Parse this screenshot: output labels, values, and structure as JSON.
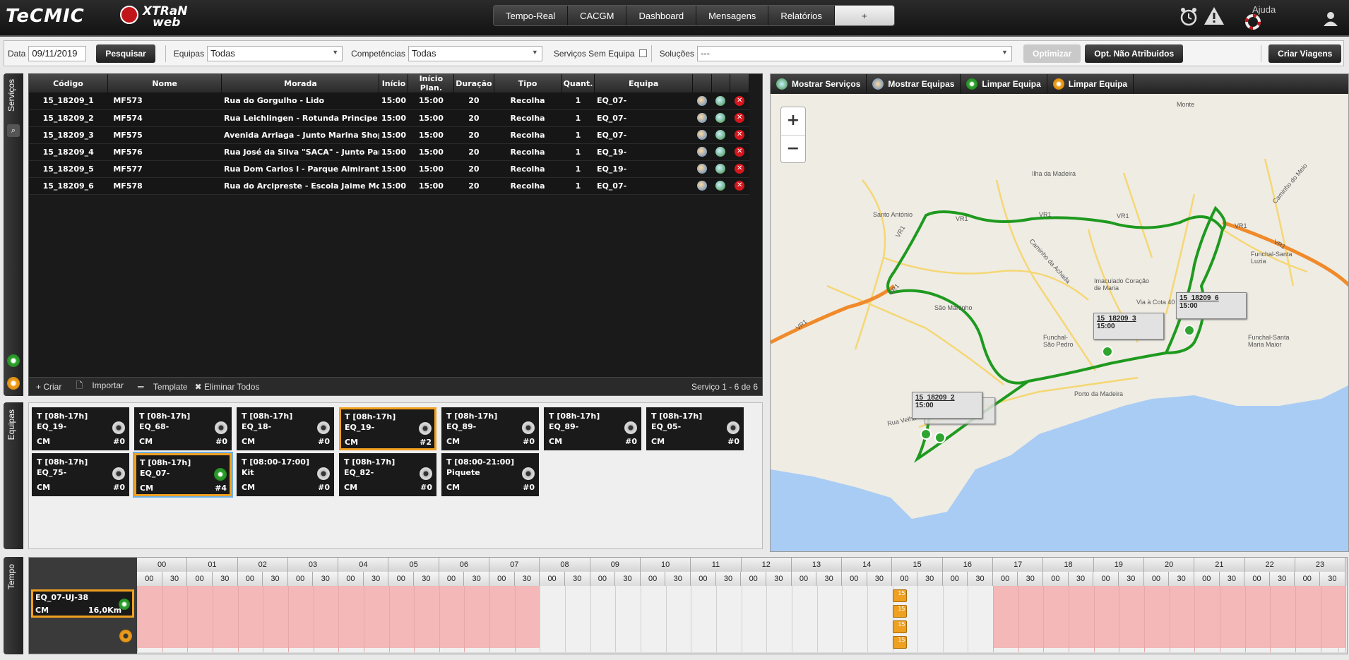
{
  "header": {
    "logo1": "TeCMIC",
    "logo2a": "XTRaN",
    "logo2b": "web",
    "nav": [
      "Tempo-Real",
      "CACGM",
      "Dashboard",
      "Mensagens",
      "Relatórios",
      "+"
    ],
    "help": "Ajuda"
  },
  "toolbar": {
    "date_label": "Data",
    "date_value": "09/11/2019",
    "search_btn": "Pesquisar",
    "teams_label": "Equipas",
    "teams_value": "Todas",
    "skills_label": "Competências",
    "skills_value": "Todas",
    "no_team_label": "Serviços Sem Equipa",
    "solutions_label": "Soluções",
    "solutions_value": "---",
    "optimize_btn": "Optimizar",
    "opt_unassigned_btn": "Opt. Não Atribuidos",
    "create_trips_btn": "Criar Viagens"
  },
  "services": {
    "tab": "Serviços",
    "columns": [
      "Código",
      "Nome",
      "Morada",
      "Início",
      "Início Plan.",
      "Duração",
      "Tipo",
      "Quant.",
      "Equipa"
    ],
    "rows": [
      [
        "15_18209_1",
        "MF573",
        "Rua do Gorgulho - Lido",
        "15:00",
        "15:00",
        "20",
        "Recolha",
        "1",
        "EQ_07-"
      ],
      [
        "15_18209_2",
        "MF574",
        "Rua Leichlingen - Rotunda Principe do",
        "15:00",
        "15:00",
        "20",
        "Recolha",
        "1",
        "EQ_07-"
      ],
      [
        "15_18209_3",
        "MF575",
        "Avenida Arriaga - Junto Marina Shoppi",
        "15:00",
        "15:00",
        "20",
        "Recolha",
        "1",
        "EQ_07-"
      ],
      [
        "15_18209_4",
        "MF576",
        "Rua José da Silva \"SACA\" - Junto Parqu",
        "15:00",
        "15:00",
        "20",
        "Recolha",
        "1",
        "EQ_19-"
      ],
      [
        "15_18209_5",
        "MF577",
        "Rua Dom Carlos I - Parque Almirante R",
        "15:00",
        "15:00",
        "20",
        "Recolha",
        "1",
        "EQ_19-"
      ],
      [
        "15_18209_6",
        "MF578",
        "Rua do Arcipreste - Escola Jaime Moni:",
        "15:00",
        "15:00",
        "20",
        "Recolha",
        "1",
        "EQ_07-"
      ]
    ],
    "footer": {
      "create": "+ Criar",
      "import": "Importar",
      "template": "Template",
      "delete_all": "✖ Eliminar Todos",
      "count": "Serviço 1 - 6 de 6"
    }
  },
  "teams": {
    "tab": "Equipas",
    "cards": [
      {
        "shift": "T [08h-17h]",
        "name": "EQ_19-",
        "skill": "CM",
        "count": "#0",
        "state": "normal"
      },
      {
        "shift": "T [08h-17h]",
        "name": "EQ_68-",
        "skill": "CM",
        "count": "#0",
        "state": "normal"
      },
      {
        "shift": "T [08h-17h]",
        "name": "EQ_18-",
        "skill": "CM",
        "count": "#0",
        "state": "normal"
      },
      {
        "shift": "T [08h-17h]",
        "name": "EQ_19-",
        "skill": "CM",
        "count": "#2",
        "state": "selected"
      },
      {
        "shift": "T [08h-17h]",
        "name": "EQ_89-",
        "skill": "CM",
        "count": "#0",
        "state": "normal"
      },
      {
        "shift": "T [08h-17h]",
        "name": "EQ_89-",
        "skill": "CM",
        "count": "#0",
        "state": "normal"
      },
      {
        "shift": "T [08h-17h]",
        "name": "EQ_05-",
        "skill": "CM",
        "count": "#0",
        "state": "normal"
      },
      {
        "shift": "T [08h-17h]",
        "name": "EQ_75-",
        "skill": "CM",
        "count": "#0",
        "state": "normal"
      },
      {
        "shift": "T [08h-17h]",
        "name": "EQ_07-",
        "skill": "CM",
        "count": "#4",
        "state": "active"
      },
      {
        "shift": "T [08:00-17:00]",
        "name": "Kit",
        "skill": "CM",
        "count": "#0",
        "state": "normal"
      },
      {
        "shift": "T [08h-17h]",
        "name": "EQ_82-",
        "skill": "CM",
        "count": "#0",
        "state": "normal"
      },
      {
        "shift": "T [08:00-21:00]",
        "name": "Piquete",
        "skill": "CM",
        "count": "#0",
        "state": "normal"
      }
    ]
  },
  "map": {
    "toolbar": [
      "Mostrar Serviços",
      "Mostrar Equipas",
      "Limpar Equipa",
      "Limpar Equipa"
    ],
    "zoom_in": "+",
    "zoom_out": "−",
    "place_names": [
      "Monte",
      "Ilha da Madeira",
      "Santo António",
      "Caminho do Meio",
      "Funchal-Santa Luzia",
      "Imaculado Coração de Maria",
      "Via à Cota 40",
      "São Martinho",
      "Caminho da Achada",
      "Funchal-São Pedro",
      "Funchal-Santa Maria Maior",
      "Porto da Madeira",
      "Rua Velha"
    ],
    "roads": [
      "VR1",
      "VR1",
      "VR1",
      "VR1",
      "VR1",
      "VR1",
      "VR1",
      "VR1"
    ],
    "markers": [
      {
        "code": "15_18209_6",
        "time": "15:00"
      },
      {
        "code": "15_18209_3",
        "time": "15:00"
      },
      {
        "code": "15_18209_2",
        "time": "15:00"
      },
      {
        "code": "15_18209_1",
        "time": ""
      }
    ],
    "colors": {
      "route": "#1e9a1e",
      "highway": "#f08a2a",
      "sea": "#a9ccf4",
      "land": "#efece4"
    }
  },
  "timeline": {
    "tab": "Tempo",
    "hours": [
      "00",
      "01",
      "02",
      "03",
      "04",
      "05",
      "06",
      "07",
      "08",
      "09",
      "10",
      "11",
      "12",
      "13",
      "14",
      "15",
      "16",
      "17",
      "18",
      "19",
      "20",
      "21",
      "22",
      "23"
    ],
    "halves": [
      "00",
      "30"
    ],
    "team": {
      "name": "EQ_07-UJ-38",
      "skill": "CM",
      "distance": "16,0Km"
    },
    "service_label": "15"
  }
}
